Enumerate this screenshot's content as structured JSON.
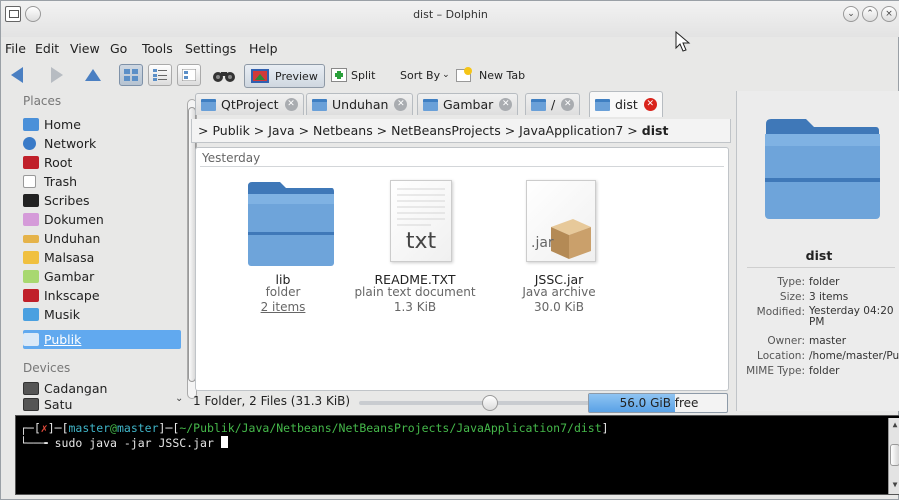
{
  "window": {
    "title": "dist – Dolphin"
  },
  "menu": [
    "File",
    "Edit",
    "View",
    "Go",
    "Tools",
    "Settings",
    "Help"
  ],
  "toolbar": {
    "preview_label": "Preview",
    "split_label": "Split",
    "sort_label": "Sort By",
    "new_tab_label": "New Tab"
  },
  "places": {
    "header": "Places",
    "items": [
      {
        "label": "Home",
        "color": "#4a90d9"
      },
      {
        "label": "Network",
        "color": "#3a7bc8"
      },
      {
        "label": "Root",
        "color": "#c0202a"
      },
      {
        "label": "Trash",
        "color": "#d8d8d8"
      },
      {
        "label": "Scribes",
        "color": "#222222"
      },
      {
        "label": "Dokumen",
        "color": "#d59bd9"
      },
      {
        "label": "Unduhan",
        "color": "#e5b34a"
      },
      {
        "label": "Malsasa",
        "color": "#f0c040"
      },
      {
        "label": "Gambar",
        "color": "#a8d870"
      },
      {
        "label": "Inkscape",
        "color": "#c0202a"
      },
      {
        "label": "Musik",
        "color": "#4aa0e0"
      },
      {
        "label": "Publik",
        "color": "#6aa0d8"
      }
    ],
    "devices_header": "Devices",
    "devices": [
      {
        "label": "Cadangan"
      },
      {
        "label": "Satu"
      }
    ]
  },
  "tabs": [
    {
      "label": "QtProject"
    },
    {
      "label": "Unduhan"
    },
    {
      "label": "Gambar"
    },
    {
      "label": "/"
    },
    {
      "label": "dist"
    }
  ],
  "breadcrumb": {
    "path": "> Publik > Java > Netbeans > NetBeansProjects > JavaApplication7 >",
    "current": "dist"
  },
  "files": {
    "group": "Yesterday",
    "items": [
      {
        "name": "lib",
        "type": "folder",
        "extra": "2 items"
      },
      {
        "name": "README.TXT",
        "type": "plain text document",
        "extra": "1.3 KiB"
      },
      {
        "name": "JSSC.jar",
        "type": "Java archive",
        "extra": "30.0 KiB"
      }
    ],
    "txt_glyph": "txt",
    "jar_glyph": ".jar"
  },
  "status": {
    "summary": "1 Folder, 2 Files (31.3 KiB)",
    "free_space": "56.0 GiB free",
    "free_fraction": 0.62,
    "zoom_fraction": 0.57
  },
  "info": {
    "name": "dist",
    "rows": [
      {
        "k": "Type:",
        "v": "folder"
      },
      {
        "k": "Size:",
        "v": "3 items"
      },
      {
        "k": "Modified:",
        "v": "Yesterday 04:20 PM"
      },
      {
        "k": "Owner:",
        "v": "master"
      },
      {
        "k": "Location:",
        "v": "/home/master/Publ"
      },
      {
        "k": "MIME Type:",
        "v": "folder"
      }
    ]
  },
  "terminal": {
    "prompt_user": "master",
    "prompt_host": "master",
    "prompt_path": "~/Publik/Java/Netbeans/NetBeansProjects/JavaApplication7/dist",
    "command": "sudo java -jar JSSC.jar "
  }
}
